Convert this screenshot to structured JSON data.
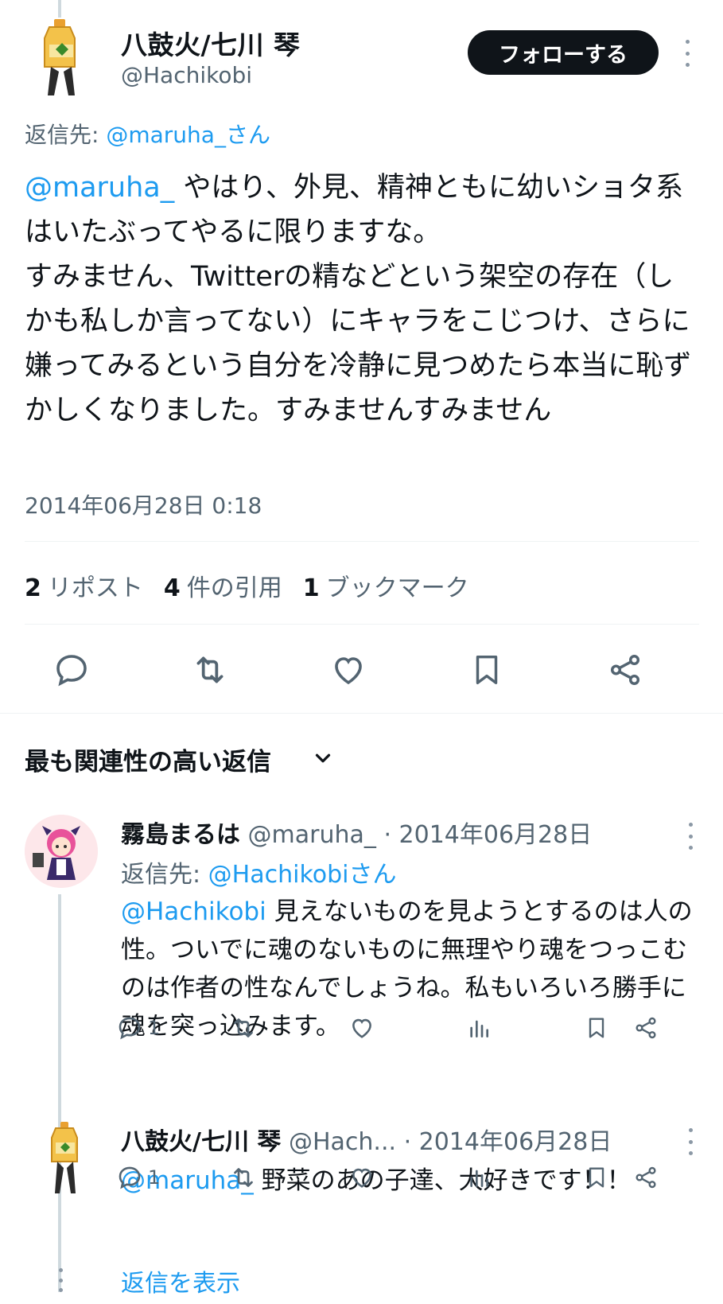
{
  "main_tweet": {
    "display_name": "八鼓火/七川 琴",
    "handle": "@Hachikobi",
    "follow_label": "フォローする",
    "replying_prefix": "返信先: ",
    "replying_to": "@maruha_さん",
    "mention": "@maruha_",
    "text": " やはり、外見、精神ともに幼いショタ系はいたぶってやるに限りますな。\nすみません、Twitterの精などという架空の存在（しかも私しか言ってない）にキャラをこじつけ、さらに嫌ってみるという自分を冷静に見つめたら本当に恥ずかしくなりました。すみませんすみません",
    "timestamp": "2014年06月28日 0:18"
  },
  "stats": {
    "reposts_count": "2",
    "reposts_label": "リポスト",
    "quotes_count": "4",
    "quotes_label": "件の引用",
    "bookmarks_count": "1",
    "bookmarks_label": "ブックマーク"
  },
  "sort": {
    "label": "最も関連性の高い返信"
  },
  "replies": [
    {
      "display_name": "霧島まるは",
      "handle": "@maruha_",
      "date": "· 2014年06月28日",
      "replying_prefix": "返信先: ",
      "replying_to": "@Hachikobiさん",
      "mention": "@Hachikobi",
      "text": " 見えないものを見ようとするのは人の性。ついでに魂のないものに無理やり魂をつっこむのは作者の性なんでしょうね。私もいろいろ勝手に魂を突っ込みます。",
      "reply_count": "1"
    },
    {
      "display_name": "八鼓火/七川 琴",
      "handle": "@Hach...",
      "date": "· 2014年06月28日",
      "mention": "@maruha_",
      "text": " 野菜のあの子達、大好きです！！",
      "reply_count": "1"
    }
  ],
  "show_replies_label": "返信を表示",
  "colors": {
    "link": "#1d9bf0",
    "muted": "#536471",
    "text": "#0f1419",
    "button_bg": "#0f1419"
  }
}
